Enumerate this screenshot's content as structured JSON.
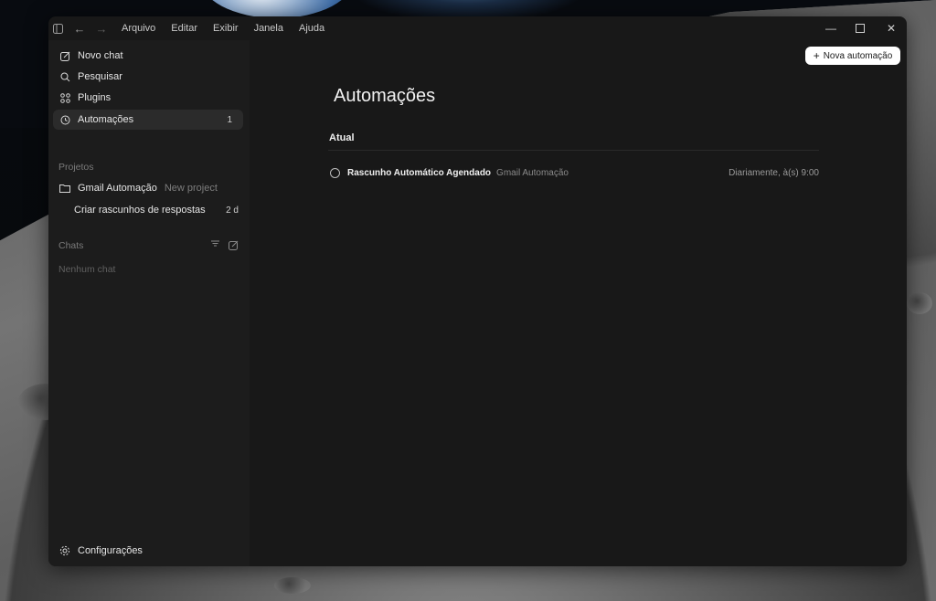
{
  "menubar": {
    "items": [
      "Arquivo",
      "Editar",
      "Exibir",
      "Janela",
      "Ajuda"
    ]
  },
  "sidebar": {
    "nav": [
      {
        "label": "Novo chat",
        "icon": "edit-icon"
      },
      {
        "label": "Pesquisar",
        "icon": "search-icon"
      },
      {
        "label": "Plugins",
        "icon": "grid-icon"
      },
      {
        "label": "Automações",
        "icon": "clock-icon",
        "count": "1"
      }
    ],
    "projects_label": "Projetos",
    "project": {
      "name": "Gmail Automação",
      "tag": "New project"
    },
    "project_chat": {
      "label": "Criar rascunhos de respostas",
      "age": "2 d"
    },
    "chats_label": "Chats",
    "chats_empty": "Nenhum chat",
    "settings_label": "Configurações"
  },
  "main": {
    "new_button": "Nova automação",
    "title": "Automações",
    "section": "Atual",
    "automations": [
      {
        "title": "Rascunho Automático Agendado",
        "project": "Gmail Automação",
        "schedule": "Diariamente, à(s) 9:00"
      }
    ]
  },
  "colors": {
    "window_bg": "#181818",
    "sidebar_bg": "#1c1c1c",
    "active_bg": "#2b2b2b"
  }
}
